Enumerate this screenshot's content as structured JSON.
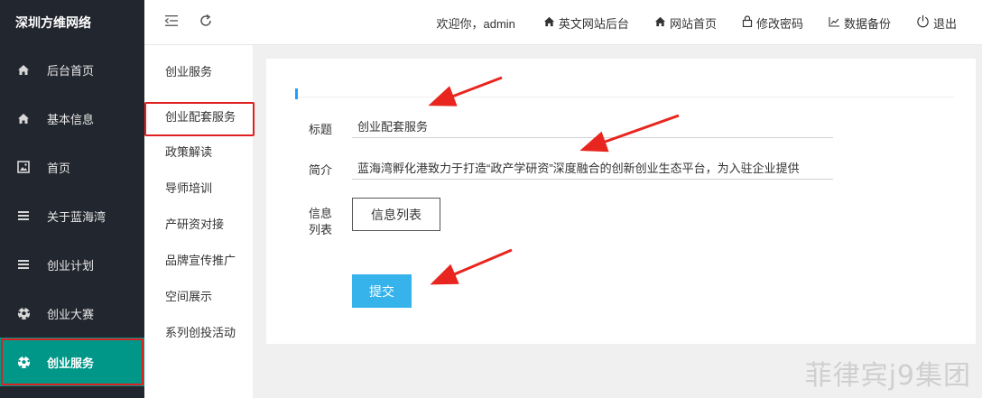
{
  "sidebar": {
    "brand": "深圳方维网络",
    "items": [
      {
        "label": "后台首页",
        "icon": "home-icon"
      },
      {
        "label": "基本信息",
        "icon": "home-icon"
      },
      {
        "label": "首页",
        "icon": "image-icon"
      },
      {
        "label": "关于蓝海湾",
        "icon": "list-icon"
      },
      {
        "label": "创业计划",
        "icon": "list-icon"
      },
      {
        "label": "创业大赛",
        "icon": "soccer-ball-icon"
      },
      {
        "label": "创业服务",
        "icon": "soccer-ball-icon",
        "active": true
      }
    ],
    "active_color": "#009688",
    "background": "#22262e"
  },
  "topbar": {
    "welcome": "欢迎你，admin",
    "links": [
      {
        "label": "英文网站后台",
        "icon": "home-icon"
      },
      {
        "label": "网站首页",
        "icon": "home-icon"
      },
      {
        "label": "修改密码",
        "icon": "lock-icon"
      },
      {
        "label": "数据备份",
        "icon": "chart-icon"
      },
      {
        "label": "退出",
        "icon": "power-icon"
      }
    ]
  },
  "submenu": {
    "items": [
      {
        "label": "创业服务"
      },
      {
        "label": "创业配套服务",
        "active": true
      },
      {
        "label": "政策解读"
      },
      {
        "label": "导师培训"
      },
      {
        "label": "产研资对接"
      },
      {
        "label": "品牌宣传推广"
      },
      {
        "label": "空间展示"
      },
      {
        "label": "系列创投活动"
      }
    ]
  },
  "form": {
    "title_label": "标题",
    "title_value": "创业配套服务",
    "intro_label": "简介",
    "intro_value": "蓝海湾孵化港致力于打造“政产学研资”深度融合的创新创业生态平台，为入驻企业提供",
    "info_label_line1": "信息",
    "info_label_line2": "列表",
    "info_button": "信息列表",
    "submit_button": "提交",
    "accent_color": "#36b3ea"
  },
  "watermark": "菲律宾j9集团"
}
